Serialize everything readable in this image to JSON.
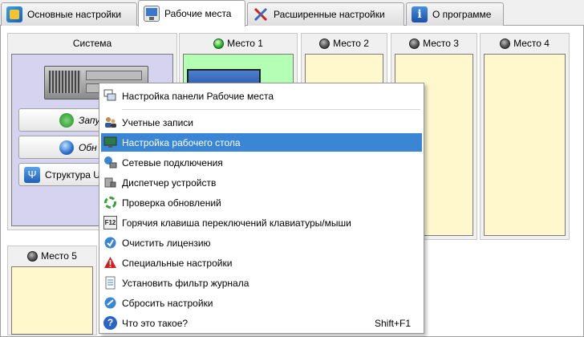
{
  "tabs": [
    {
      "label": "Основные настройки",
      "icon": "settings-icon"
    },
    {
      "label": "Рабочие места",
      "icon": "workplaces-icon",
      "active": true
    },
    {
      "label": "Расширенные настройки",
      "icon": "tools-icon"
    },
    {
      "label": "О программе",
      "icon": "info-icon"
    }
  ],
  "system": {
    "title": "Система",
    "buttons": [
      "Запус",
      "Обн",
      "Структура U"
    ]
  },
  "places": [
    {
      "label": "Место 1",
      "status": "green"
    },
    {
      "label": "Место 2",
      "status": "gray"
    },
    {
      "label": "Место 3",
      "status": "gray"
    },
    {
      "label": "Место 4",
      "status": "gray"
    },
    {
      "label": "Место 5",
      "status": "gray"
    }
  ],
  "menu": {
    "items": [
      {
        "label": "Настройка панели Рабочие места",
        "icon": "panel-icon"
      },
      {
        "label": "Учетные записи",
        "icon": "users-icon"
      },
      {
        "label": "Настройка рабочего стола",
        "icon": "desktop-icon",
        "highlighted": true
      },
      {
        "label": "Сетевые подключения",
        "icon": "network-icon"
      },
      {
        "label": "Диспетчер устройств",
        "icon": "devices-icon"
      },
      {
        "label": "Проверка обновлений",
        "icon": "update-icon"
      },
      {
        "label": "Горячия клавиша переключений клавиатуры/мыши",
        "icon": "f12-key-icon"
      },
      {
        "label": "Очистить лицензию",
        "icon": "license-icon"
      },
      {
        "label": "Специальные настройки",
        "icon": "warning-icon"
      },
      {
        "label": "Установить фильтр журнала",
        "icon": "filter-log-icon"
      },
      {
        "label": "Сбросить настройки",
        "icon": "reset-icon"
      },
      {
        "label": "Что это такое?",
        "icon": "help-icon",
        "shortcut": "Shift+F1"
      }
    ]
  },
  "colors": {
    "accent": "#3b86d4",
    "place_active": "#b3ffb3",
    "place_idle": "#fff8cc",
    "system_bg": "#d6d3f0"
  }
}
